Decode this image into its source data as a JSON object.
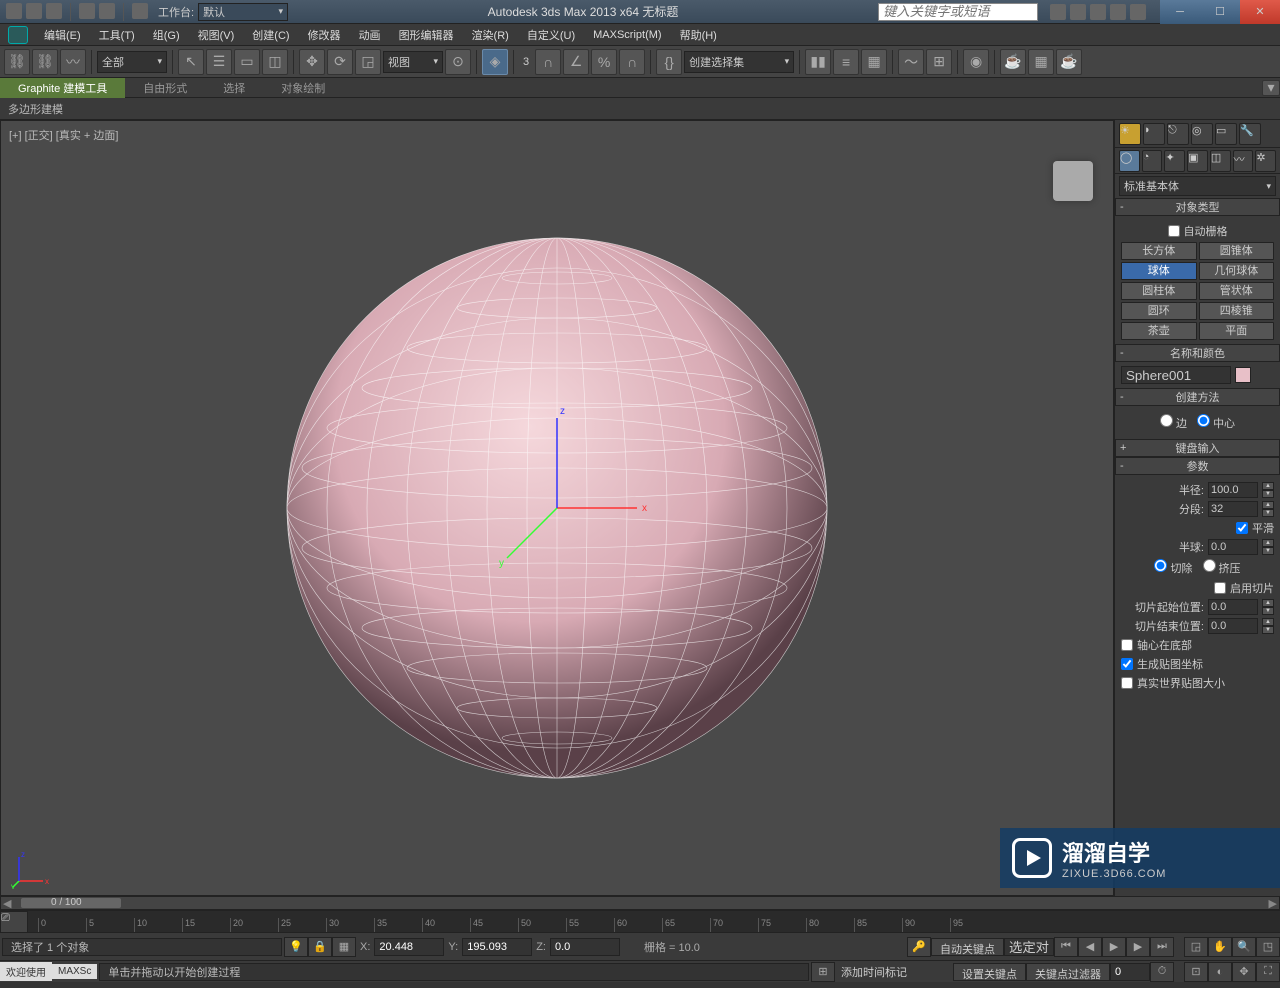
{
  "titlebar": {
    "workspace_label": "工作台:",
    "workspace_value": "默认",
    "app_title": "Autodesk 3ds Max  2013 x64   无标题",
    "search_placeholder": "键入关键字或短语"
  },
  "menu": {
    "edit": "编辑(E)",
    "tools": "工具(T)",
    "group": "组(G)",
    "views": "视图(V)",
    "create": "创建(C)",
    "modifiers": "修改器",
    "animation": "动画",
    "graph": "图形编辑器",
    "render": "渲染(R)",
    "custom": "自定义(U)",
    "maxscript": "MAXScript(M)",
    "help": "帮助(H)"
  },
  "toolbar": {
    "all_filter": "全部",
    "view_dd": "视图",
    "selset_dd": "创建选择集"
  },
  "ribbon": {
    "tab_graphite": "Graphite 建模工具",
    "tab_freeform": "自由形式",
    "tab_select": "选择",
    "tab_objpaint": "对象绘制",
    "sub_polymodel": "多边形建模"
  },
  "viewport": {
    "label": "[+] [正交] [真实 + 边面]"
  },
  "command_panel": {
    "dropdown": "标准基本体",
    "object_type_header": "对象类型",
    "auto_grid": "自动栅格",
    "prims": {
      "box": "长方体",
      "cone": "圆锥体",
      "sphere": "球体",
      "geosphere": "几何球体",
      "cylinder": "圆柱体",
      "tube": "管状体",
      "torus": "圆环",
      "pyramid": "四棱锥",
      "teapot": "茶壶",
      "plane": "平面"
    },
    "name_color_header": "名称和颜色",
    "obj_name": "Sphere001",
    "creation_method_header": "创建方法",
    "edge": "边",
    "center": "中心",
    "keyboard_entry_header": "键盘输入",
    "params_header": "参数",
    "radius_label": "半径:",
    "radius_value": "100.0",
    "segments_label": "分段:",
    "segments_value": "32",
    "smooth": "平滑",
    "hemisphere_label": "半球:",
    "hemisphere_value": "0.0",
    "chop": "切除",
    "squash": "挤压",
    "slice_on": "启用切片",
    "slice_from_label": "切片起始位置:",
    "slice_from_value": "0.0",
    "slice_to_label": "切片结束位置:",
    "slice_to_value": "0.0",
    "base_pivot": "轴心在底部",
    "gen_uv": "生成贴图坐标",
    "real_world": "真实世界贴图大小"
  },
  "timeline": {
    "frame_range": "0 / 100",
    "ticks": [
      0,
      5,
      10,
      15,
      20,
      25,
      30,
      35,
      40,
      45,
      50,
      55,
      60,
      65,
      70,
      75,
      80,
      85,
      90,
      95
    ]
  },
  "status": {
    "selected_msg": "选择了 1 个对象",
    "prompt_msg": "单击并拖动以开始创建过程",
    "x_label": "X:",
    "x_value": "20.448",
    "y_label": "Y:",
    "y_value": "195.093",
    "z_label": "Z:",
    "z_value": "0.0",
    "grid_label": "栅格 = 10.0",
    "autokey": "自动关键点",
    "selected_dd": "选定对",
    "setkey": "设置关键点",
    "keyfilter": "关键点过滤器",
    "add_time_tag": "添加时间标记",
    "welcome": "欢迎使用",
    "maxscript": "MAXSc"
  },
  "watermark": {
    "main": "溜溜自学",
    "sub": "ZIXUE.3D66.COM"
  },
  "chart_data": null
}
